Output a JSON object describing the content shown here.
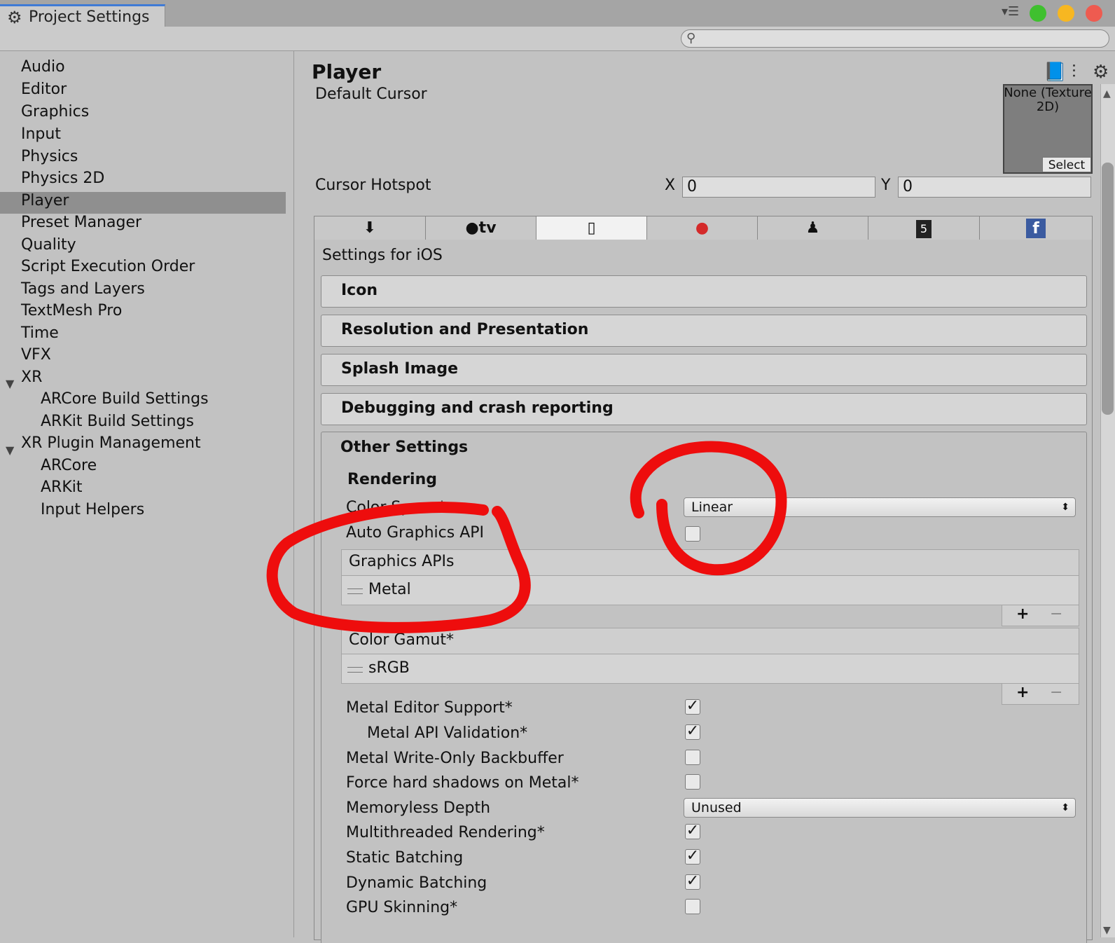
{
  "window": {
    "title": "Project Settings",
    "icons": {
      "settings": "gear-icon",
      "menu": "menu-icon",
      "search": "search-icon"
    },
    "buttons": {
      "zoom_color": "#3fc02f",
      "minimize_color": "#f7b721",
      "close_color": "#ee5b50"
    }
  },
  "sidebar": {
    "items": [
      "Audio",
      "Editor",
      "Graphics",
      "Input",
      "Physics",
      "Physics 2D",
      "Player",
      "Preset Manager",
      "Quality",
      "Script Execution Order",
      "Tags and Layers",
      "TextMesh Pro",
      "Time",
      "VFX",
      "XR",
      "ARCore Build Settings",
      "ARKit Build Settings",
      "XR Plugin Management",
      "ARCore",
      "ARKit",
      "Input Helpers"
    ],
    "selected": "Player"
  },
  "header": {
    "title": "Player",
    "icons": [
      "help-icon",
      "presets-icon",
      "settings-icon"
    ]
  },
  "cursor": {
    "default_label": "Default Cursor",
    "texture_label": "None (Texture 2D)",
    "select_label": "Select",
    "hotspot_label": "Cursor Hotspot",
    "x_label": "X",
    "x_value": "0",
    "y_label": "Y",
    "y_value": "0"
  },
  "platform_tabs": {
    "items": [
      "download-icon",
      "apple-tv-icon",
      "iphone-icon",
      "stadia-icon",
      "android-icon",
      "html5-icon",
      "facebook-icon"
    ],
    "appletv_text": "tv",
    "active": "iphone-icon"
  },
  "settings": {
    "title": "Settings for iOS",
    "sections": [
      "Icon",
      "Resolution and Presentation",
      "Splash Image",
      "Debugging and crash reporting",
      "Other Settings"
    ],
    "rendering_header": "Rendering",
    "color_space_label": "Color Space*",
    "color_space_value": "Linear",
    "auto_graphics_label": "Auto Graphics API",
    "graphics_apis_label": "Graphics APIs",
    "graphics_apis_items": [
      "Metal"
    ],
    "color_gamut_label": "Color Gamut*",
    "color_gamut_items": [
      "sRGB"
    ],
    "plus": "+",
    "minus": "−",
    "checkmark": "✓",
    "dropdown_arrow": "⬍",
    "options": [
      {
        "label": "Metal Editor Support*",
        "checked": true
      },
      {
        "label": "Metal API Validation*",
        "checked": true
      },
      {
        "label": "Metal Write-Only Backbuffer",
        "checked": false
      },
      {
        "label": "Force hard shadows on Metal*",
        "checked": false
      },
      {
        "label": "Memoryless Depth",
        "value": "Unused"
      },
      {
        "label": "Multithreaded Rendering*",
        "checked": true
      },
      {
        "label": "Static Batching",
        "checked": true
      },
      {
        "label": "Dynamic Batching",
        "checked": true
      },
      {
        "label": "GPU Skinning*",
        "checked": false
      }
    ]
  },
  "annotation_color": "#ee0d0d"
}
